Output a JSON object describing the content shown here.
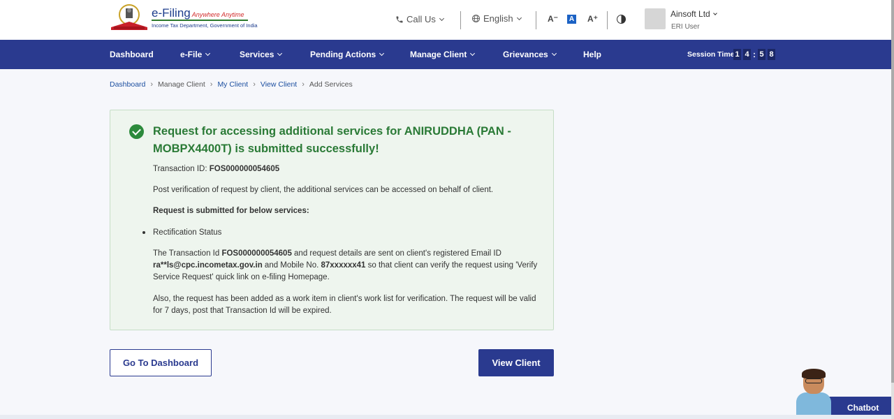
{
  "header": {
    "brand_name": "e-Filing",
    "brand_tagline": "Anywhere Anytime",
    "brand_subtitle": "Income Tax Department, Government of India",
    "call_label": "Call Us",
    "language": "English",
    "font_decrease": "A⁻",
    "font_normal": "A",
    "font_increase": "A⁺",
    "user_name": "Ainsoft Ltd",
    "user_role": "ERI User"
  },
  "nav": {
    "items": [
      "Dashboard",
      "e-File",
      "Services",
      "Pending Actions",
      "Manage Client",
      "Grievances",
      "Help"
    ],
    "session_label": "Session Time",
    "session_digits": [
      "1",
      "4",
      "5",
      "8"
    ]
  },
  "breadcrumb": [
    "Dashboard",
    "Manage Client",
    "My Client",
    "View Client",
    "Add Services"
  ],
  "card": {
    "title": "Request for accessing additional services for ANIRUDDHA (PAN - MOBPX4400T) is submitted successfully!",
    "txn_label": "Transaction ID: ",
    "txn_id": "FOS000000054605",
    "post_verification": "Post verification of request by client, the additional services can be accessed on behalf of client.",
    "services_heading": "Request is submitted for below services:",
    "services": [
      "Rectification Status"
    ],
    "details_1": "The Transaction Id ",
    "details_txn": "FOS000000054605",
    "details_2": " and request details are sent on client's registered Email ID ",
    "details_email": "ra**ls@cpc.incometax.gov.in",
    "details_3": " and Mobile No. ",
    "details_mobile": "87xxxxxx41",
    "details_4": " so that client can verify the request using 'Verify Service Request' quick link on e-filing Homepage.",
    "work_item_note": "Also, the request has been added as a work item in client's work list for verification. The request will be valid for 7 days, post that Transaction Id will be expired."
  },
  "buttons": {
    "go_dashboard": "Go To Dashboard",
    "view_client": "View Client"
  },
  "chatbot": {
    "label": "Chatbot"
  },
  "colors": {
    "nav_bg": "#2a3a8f",
    "success": "#2a7a36",
    "card_bg": "#eef5ee"
  }
}
